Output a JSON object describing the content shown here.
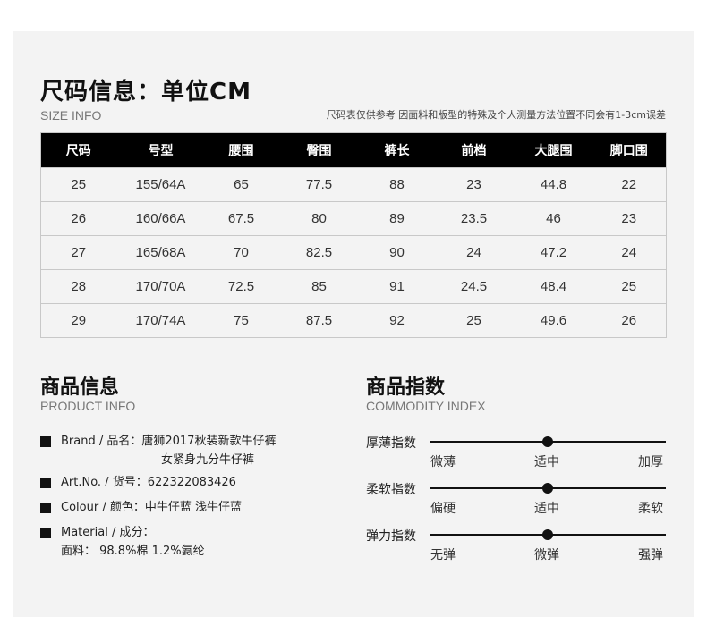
{
  "size": {
    "title": "尺码信息：单位CM",
    "subtitle": "SIZE INFO",
    "note": "尺码表仅供参考 因面料和版型的特殊及个人测量方法位置不同会有1-3cm误差",
    "headers": [
      "尺码",
      "号型",
      "腰围",
      "臀围",
      "裤长",
      "前档",
      "大腿围",
      "脚口围"
    ],
    "rows": [
      [
        "25",
        "155/64A",
        "65",
        "77.5",
        "88",
        "23",
        "44.8",
        "22"
      ],
      [
        "26",
        "160/66A",
        "67.5",
        "80",
        "89",
        "23.5",
        "46",
        "23"
      ],
      [
        "27",
        "165/68A",
        "70",
        "82.5",
        "90",
        "24",
        "47.2",
        "24"
      ],
      [
        "28",
        "170/70A",
        "72.5",
        "85",
        "91",
        "24.5",
        "48.4",
        "25"
      ],
      [
        "29",
        "170/74A",
        "75",
        "87.5",
        "92",
        "25",
        "49.6",
        "26"
      ]
    ]
  },
  "product": {
    "title": "商品信息",
    "subtitle": "PRODUCT INFO",
    "brand_line1": "Brand / 品名：唐狮2017秋装新款牛仔裤",
    "brand_line2": "女紧身九分牛仔裤",
    "artno": "Art.No. / 货号：622322083426",
    "colour": "Colour / 颜色：中牛仔蓝 浅牛仔蓝",
    "material_line1": "Material / 成分：",
    "material_line2": "面料： 98.8%棉 1.2%氨纶"
  },
  "commodity": {
    "title": "商品指数",
    "subtitle": "COMMODITY INDEX",
    "indexes": [
      {
        "label": "厚薄指数",
        "ticks": [
          "微薄",
          "适中",
          "加厚"
        ],
        "level": 0.5
      },
      {
        "label": "柔软指数",
        "ticks": [
          "偏硬",
          "适中",
          "柔软"
        ],
        "level": 0.5
      },
      {
        "label": "弹力指数",
        "ticks": [
          "无弹",
          "微弹",
          "强弹"
        ],
        "level": 0.5
      }
    ]
  }
}
